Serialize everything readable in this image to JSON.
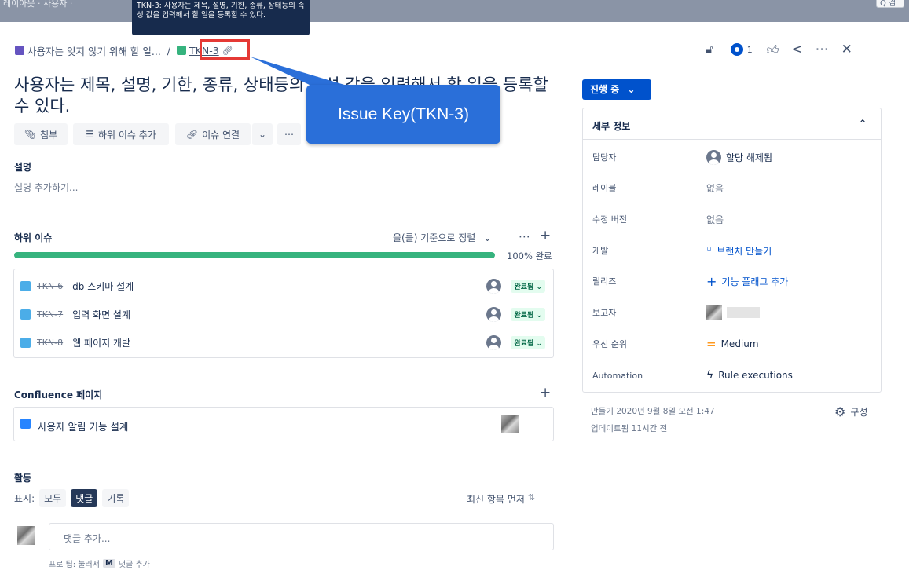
{
  "top": {
    "crumb": "레이아웃 · 사용자 · ",
    "search": "Q 검"
  },
  "tooltip": {
    "text": "TKN-3: 사용자는 제목, 설명, 기한, 종류, 상태등의 속성 값을 입력해서 할 일을 등록할 수 있다."
  },
  "breadcrumb": {
    "epic": "사용자는 잊지 않기 위해 할 일...",
    "separator": "/",
    "key": "TKN-3"
  },
  "header_actions": {
    "watch_count": "1"
  },
  "title": "사용자는 제목, 설명, 기한, 종류, 상태등의 속성 값을 입력해서 할 일을 등록할 수 있다.",
  "callout": "Issue Key(TKN-3)",
  "toolbar": {
    "attach": "첨부",
    "add_subtask": "하위 이슈 추가",
    "link_issue": "이슈 연결"
  },
  "description": {
    "label": "설명",
    "placeholder": "설명 추가하기..."
  },
  "subtasks": {
    "label": "하위 이슈",
    "sort": "을(를) 기준으로 정렬",
    "progress_text": "100% 완료",
    "progress": 1.0,
    "items": [
      {
        "key": "TKN-6",
        "summary": "db 스키마 설계",
        "status": "완료됨"
      },
      {
        "key": "TKN-7",
        "summary": "입력 화면 설계",
        "status": "완료됨"
      },
      {
        "key": "TKN-8",
        "summary": "웹 페이지 개발",
        "status": "완료됨"
      }
    ]
  },
  "confluence": {
    "label": "Confluence 페이지",
    "page": "사용자 알림 기능 설계"
  },
  "activity": {
    "label": "활동",
    "show": "표시:",
    "filters": [
      "모두",
      "댓글",
      "기록"
    ],
    "active_filter": "댓글",
    "order": "최신 항목 먼저",
    "comment_placeholder": "댓글 추가...",
    "tip_prefix": "프로 팁: 눌러서",
    "tip_key": "M",
    "tip_suffix": "댓글 추가"
  },
  "status": {
    "label": "진행 중"
  },
  "details": {
    "header": "세부 정보",
    "rows": [
      {
        "key": "담당자",
        "value": "할당 해제됨"
      },
      {
        "key": "레이블",
        "value": "없음"
      },
      {
        "key": "수정 버전",
        "value": "없음"
      },
      {
        "key": "개발",
        "value": "브랜치 만들기"
      },
      {
        "key": "릴리즈",
        "value": "기능 플래그 추가"
      },
      {
        "key": "보고자",
        "value": ""
      },
      {
        "key": "우선 순위",
        "value": "Medium"
      },
      {
        "key": "Automation",
        "value": "Rule executions"
      }
    ]
  },
  "meta": {
    "created": "만들기 2020년 9월 8일 오전 1:47",
    "updated": "업데이트됨 11시간 전",
    "configure": "구성"
  },
  "colors": {
    "primary": "#0052cc",
    "progress": "#36b37e",
    "callout": "#2a6fd9",
    "highlight": "#e53935"
  }
}
